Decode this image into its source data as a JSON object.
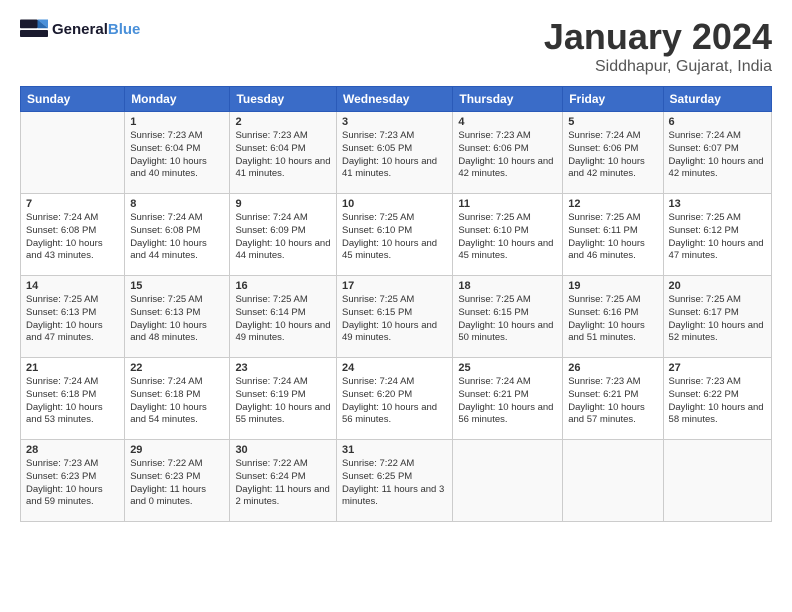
{
  "header": {
    "logo_line1": "General",
    "logo_line2": "Blue",
    "month": "January 2024",
    "location": "Siddhapur, Gujarat, India"
  },
  "columns": [
    "Sunday",
    "Monday",
    "Tuesday",
    "Wednesday",
    "Thursday",
    "Friday",
    "Saturday"
  ],
  "weeks": [
    [
      {
        "day": "",
        "sunrise": "",
        "sunset": "",
        "daylight": ""
      },
      {
        "day": "1",
        "sunrise": "Sunrise: 7:23 AM",
        "sunset": "Sunset: 6:04 PM",
        "daylight": "Daylight: 10 hours and 40 minutes."
      },
      {
        "day": "2",
        "sunrise": "Sunrise: 7:23 AM",
        "sunset": "Sunset: 6:04 PM",
        "daylight": "Daylight: 10 hours and 41 minutes."
      },
      {
        "day": "3",
        "sunrise": "Sunrise: 7:23 AM",
        "sunset": "Sunset: 6:05 PM",
        "daylight": "Daylight: 10 hours and 41 minutes."
      },
      {
        "day": "4",
        "sunrise": "Sunrise: 7:23 AM",
        "sunset": "Sunset: 6:06 PM",
        "daylight": "Daylight: 10 hours and 42 minutes."
      },
      {
        "day": "5",
        "sunrise": "Sunrise: 7:24 AM",
        "sunset": "Sunset: 6:06 PM",
        "daylight": "Daylight: 10 hours and 42 minutes."
      },
      {
        "day": "6",
        "sunrise": "Sunrise: 7:24 AM",
        "sunset": "Sunset: 6:07 PM",
        "daylight": "Daylight: 10 hours and 42 minutes."
      }
    ],
    [
      {
        "day": "7",
        "sunrise": "Sunrise: 7:24 AM",
        "sunset": "Sunset: 6:08 PM",
        "daylight": "Daylight: 10 hours and 43 minutes."
      },
      {
        "day": "8",
        "sunrise": "Sunrise: 7:24 AM",
        "sunset": "Sunset: 6:08 PM",
        "daylight": "Daylight: 10 hours and 44 minutes."
      },
      {
        "day": "9",
        "sunrise": "Sunrise: 7:24 AM",
        "sunset": "Sunset: 6:09 PM",
        "daylight": "Daylight: 10 hours and 44 minutes."
      },
      {
        "day": "10",
        "sunrise": "Sunrise: 7:25 AM",
        "sunset": "Sunset: 6:10 PM",
        "daylight": "Daylight: 10 hours and 45 minutes."
      },
      {
        "day": "11",
        "sunrise": "Sunrise: 7:25 AM",
        "sunset": "Sunset: 6:10 PM",
        "daylight": "Daylight: 10 hours and 45 minutes."
      },
      {
        "day": "12",
        "sunrise": "Sunrise: 7:25 AM",
        "sunset": "Sunset: 6:11 PM",
        "daylight": "Daylight: 10 hours and 46 minutes."
      },
      {
        "day": "13",
        "sunrise": "Sunrise: 7:25 AM",
        "sunset": "Sunset: 6:12 PM",
        "daylight": "Daylight: 10 hours and 47 minutes."
      }
    ],
    [
      {
        "day": "14",
        "sunrise": "Sunrise: 7:25 AM",
        "sunset": "Sunset: 6:13 PM",
        "daylight": "Daylight: 10 hours and 47 minutes."
      },
      {
        "day": "15",
        "sunrise": "Sunrise: 7:25 AM",
        "sunset": "Sunset: 6:13 PM",
        "daylight": "Daylight: 10 hours and 48 minutes."
      },
      {
        "day": "16",
        "sunrise": "Sunrise: 7:25 AM",
        "sunset": "Sunset: 6:14 PM",
        "daylight": "Daylight: 10 hours and 49 minutes."
      },
      {
        "day": "17",
        "sunrise": "Sunrise: 7:25 AM",
        "sunset": "Sunset: 6:15 PM",
        "daylight": "Daylight: 10 hours and 49 minutes."
      },
      {
        "day": "18",
        "sunrise": "Sunrise: 7:25 AM",
        "sunset": "Sunset: 6:15 PM",
        "daylight": "Daylight: 10 hours and 50 minutes."
      },
      {
        "day": "19",
        "sunrise": "Sunrise: 7:25 AM",
        "sunset": "Sunset: 6:16 PM",
        "daylight": "Daylight: 10 hours and 51 minutes."
      },
      {
        "day": "20",
        "sunrise": "Sunrise: 7:25 AM",
        "sunset": "Sunset: 6:17 PM",
        "daylight": "Daylight: 10 hours and 52 minutes."
      }
    ],
    [
      {
        "day": "21",
        "sunrise": "Sunrise: 7:24 AM",
        "sunset": "Sunset: 6:18 PM",
        "daylight": "Daylight: 10 hours and 53 minutes."
      },
      {
        "day": "22",
        "sunrise": "Sunrise: 7:24 AM",
        "sunset": "Sunset: 6:18 PM",
        "daylight": "Daylight: 10 hours and 54 minutes."
      },
      {
        "day": "23",
        "sunrise": "Sunrise: 7:24 AM",
        "sunset": "Sunset: 6:19 PM",
        "daylight": "Daylight: 10 hours and 55 minutes."
      },
      {
        "day": "24",
        "sunrise": "Sunrise: 7:24 AM",
        "sunset": "Sunset: 6:20 PM",
        "daylight": "Daylight: 10 hours and 56 minutes."
      },
      {
        "day": "25",
        "sunrise": "Sunrise: 7:24 AM",
        "sunset": "Sunset: 6:21 PM",
        "daylight": "Daylight: 10 hours and 56 minutes."
      },
      {
        "day": "26",
        "sunrise": "Sunrise: 7:23 AM",
        "sunset": "Sunset: 6:21 PM",
        "daylight": "Daylight: 10 hours and 57 minutes."
      },
      {
        "day": "27",
        "sunrise": "Sunrise: 7:23 AM",
        "sunset": "Sunset: 6:22 PM",
        "daylight": "Daylight: 10 hours and 58 minutes."
      }
    ],
    [
      {
        "day": "28",
        "sunrise": "Sunrise: 7:23 AM",
        "sunset": "Sunset: 6:23 PM",
        "daylight": "Daylight: 10 hours and 59 minutes."
      },
      {
        "day": "29",
        "sunrise": "Sunrise: 7:22 AM",
        "sunset": "Sunset: 6:23 PM",
        "daylight": "Daylight: 11 hours and 0 minutes."
      },
      {
        "day": "30",
        "sunrise": "Sunrise: 7:22 AM",
        "sunset": "Sunset: 6:24 PM",
        "daylight": "Daylight: 11 hours and 2 minutes."
      },
      {
        "day": "31",
        "sunrise": "Sunrise: 7:22 AM",
        "sunset": "Sunset: 6:25 PM",
        "daylight": "Daylight: 11 hours and 3 minutes."
      },
      {
        "day": "",
        "sunrise": "",
        "sunset": "",
        "daylight": ""
      },
      {
        "day": "",
        "sunrise": "",
        "sunset": "",
        "daylight": ""
      },
      {
        "day": "",
        "sunrise": "",
        "sunset": "",
        "daylight": ""
      }
    ]
  ]
}
